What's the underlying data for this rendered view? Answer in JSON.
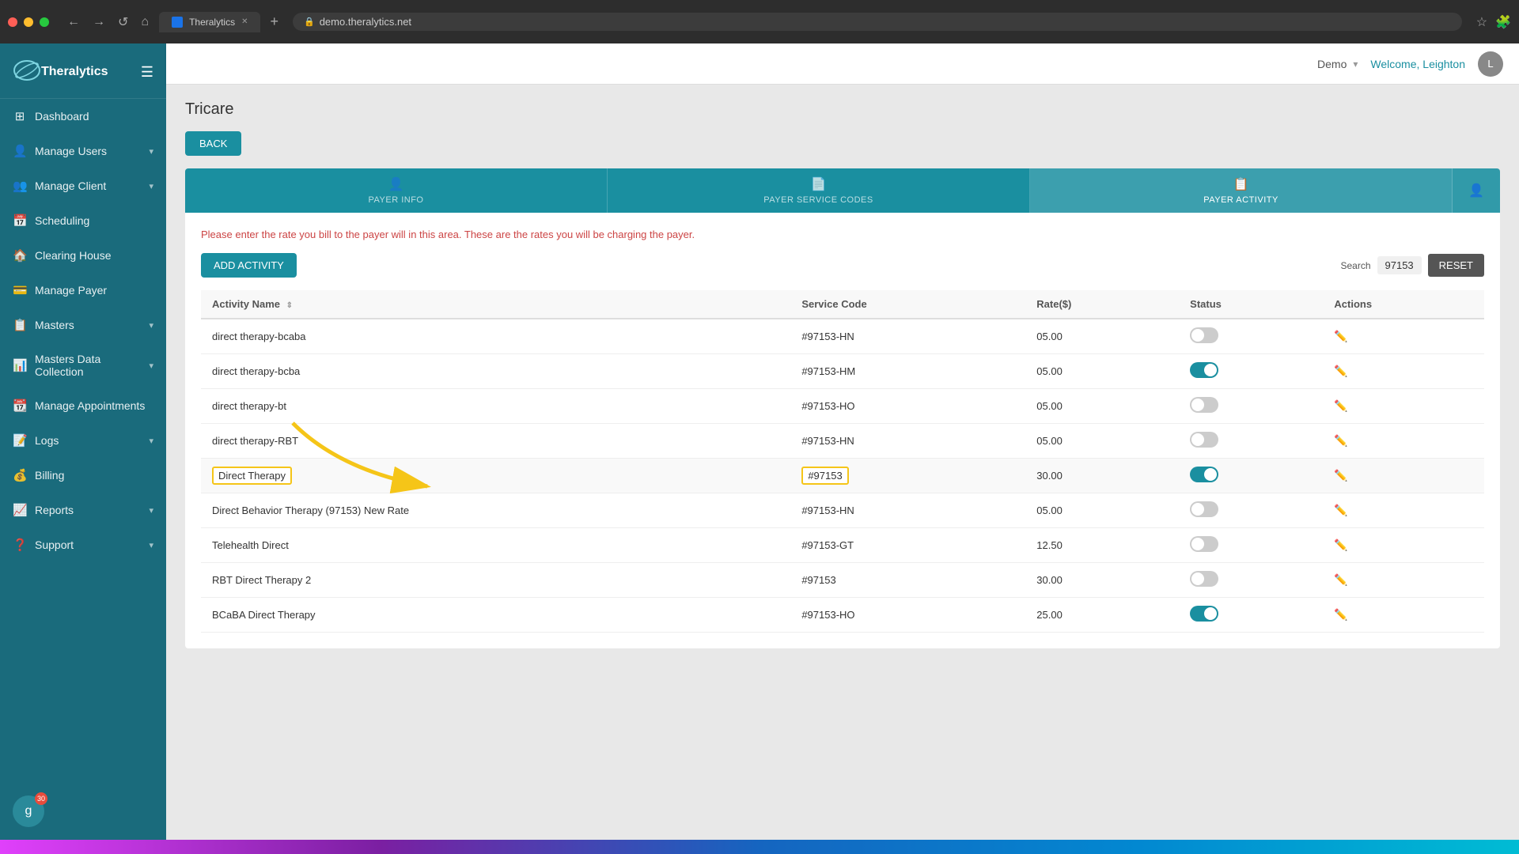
{
  "browser": {
    "tab_title": "Theralytics",
    "tab_new": "+",
    "address": "demo.theralytics.net",
    "address_lock": "🔒"
  },
  "sidebar": {
    "logo": "Theralytics",
    "menu_icon": "☰",
    "items": [
      {
        "id": "dashboard",
        "label": "Dashboard",
        "icon": "⊞",
        "has_chevron": false
      },
      {
        "id": "manage-users",
        "label": "Manage Users",
        "icon": "👤",
        "has_chevron": true
      },
      {
        "id": "manage-client",
        "label": "Manage Client",
        "icon": "👥",
        "has_chevron": true
      },
      {
        "id": "scheduling",
        "label": "Scheduling",
        "icon": "📅",
        "has_chevron": false
      },
      {
        "id": "clearing-house",
        "label": "Clearing House",
        "icon": "🏠",
        "has_chevron": false
      },
      {
        "id": "manage-payer",
        "label": "Manage Payer",
        "icon": "💳",
        "has_chevron": false
      },
      {
        "id": "masters",
        "label": "Masters",
        "icon": "📋",
        "has_chevron": true
      },
      {
        "id": "masters-data",
        "label": "Masters Data Collection",
        "icon": "📊",
        "has_chevron": true
      },
      {
        "id": "manage-appointments",
        "label": "Manage Appointments",
        "icon": "📆",
        "has_chevron": false
      },
      {
        "id": "logs",
        "label": "Logs",
        "icon": "📝",
        "has_chevron": true
      },
      {
        "id": "billing",
        "label": "Billing",
        "icon": "💰",
        "has_chevron": false
      },
      {
        "id": "reports",
        "label": "Reports",
        "icon": "📈",
        "has_chevron": true
      },
      {
        "id": "support",
        "label": "Support",
        "icon": "❓",
        "has_chevron": true
      }
    ],
    "avatar_letter": "g",
    "avatar_badge": "30"
  },
  "topbar": {
    "demo_label": "Demo",
    "welcome_text": "Welcome, Leighton"
  },
  "page": {
    "title": "Tricare",
    "back_button": "BACK",
    "instruction": "Please enter the rate you bill to the payer will in this area. These are the rates you will be charging the payer.",
    "tabs": [
      {
        "id": "payer-info",
        "label": "PAYER INFO",
        "icon": "👤"
      },
      {
        "id": "payer-service-codes",
        "label": "PAYER SERVICE CODES",
        "icon": "📄"
      },
      {
        "id": "payer-activity",
        "label": "PAYER ACTIVITY",
        "icon": "📋",
        "active": true
      }
    ],
    "add_activity_button": "ADD ACTIVITY",
    "search_label": "Search",
    "search_value": "97153",
    "reset_button": "RESET",
    "table": {
      "columns": [
        "Activity Name",
        "Service Code",
        "Rate($)",
        "Status",
        "Actions"
      ],
      "rows": [
        {
          "name": "direct therapy-bcaba",
          "service_code": "#97153-HN",
          "rate": "05.00",
          "active": false,
          "highlighted_name": false,
          "highlighted_code": false
        },
        {
          "name": "direct therapy-bcba",
          "service_code": "#97153-HM",
          "rate": "05.00",
          "active": true,
          "highlighted_name": false,
          "highlighted_code": false
        },
        {
          "name": "direct therapy-bt",
          "service_code": "#97153-HO",
          "rate": "05.00",
          "active": false,
          "highlighted_name": false,
          "highlighted_code": false
        },
        {
          "name": "direct therapy-RBT",
          "service_code": "#97153-HN",
          "rate": "05.00",
          "active": false,
          "highlighted_name": false,
          "highlighted_code": false
        },
        {
          "name": "Direct Therapy",
          "service_code": "#97153",
          "rate": "30.00",
          "active": true,
          "highlighted_name": true,
          "highlighted_code": true
        },
        {
          "name": "Direct Behavior Therapy (97153) New Rate",
          "service_code": "#97153-HN",
          "rate": "05.00",
          "active": false,
          "highlighted_name": false,
          "highlighted_code": false
        },
        {
          "name": "Telehealth Direct",
          "service_code": "#97153-GT",
          "rate": "12.50",
          "active": false,
          "highlighted_name": false,
          "highlighted_code": false
        },
        {
          "name": "RBT Direct Therapy 2",
          "service_code": "#97153",
          "rate": "30.00",
          "active": false,
          "highlighted_name": false,
          "highlighted_code": false
        },
        {
          "name": "BCaBA Direct Therapy",
          "service_code": "#97153-HO",
          "rate": "25.00",
          "active": true,
          "highlighted_name": false,
          "highlighted_code": false
        }
      ]
    }
  },
  "colors": {
    "sidebar_bg": "#1a6b7c",
    "primary": "#1a8fa0",
    "accent": "#f5c518",
    "highlight_arrow": "#f5c518"
  }
}
